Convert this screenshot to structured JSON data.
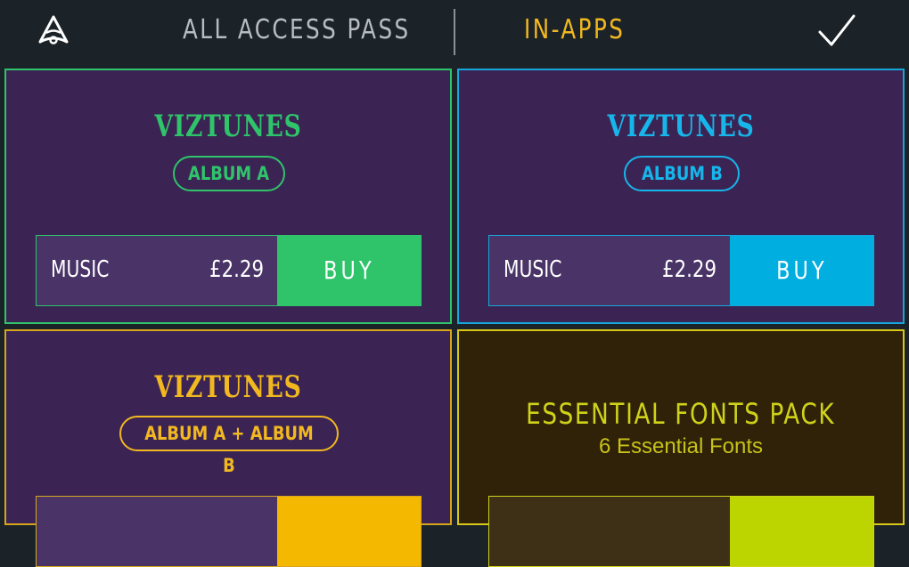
{
  "header": {
    "logo_icon": "app-logo-icon",
    "tab_all_access": "ALL ACCESS PASS",
    "tab_in_apps": "IN-APPS",
    "done_icon": "checkmark-icon"
  },
  "colors": {
    "green": "#2fc46a",
    "blue": "#17a6d9",
    "gold": "#f2b820",
    "lime": "#cfd21a"
  },
  "products": [
    {
      "brand": "VIZTUNES",
      "tag": "ALBUM A",
      "type": "MUSIC",
      "price": "£2.29",
      "buy": "BUY"
    },
    {
      "brand": "VIZTUNES",
      "tag": "ALBUM B",
      "type": "MUSIC",
      "price": "£2.29",
      "buy": "BUY"
    },
    {
      "brand": "VIZTUNES",
      "tag": "ALBUM A + ALBUM B"
    },
    {
      "title": "ESSENTIAL FONTS PACK",
      "subtitle": "6 Essential Fonts"
    }
  ]
}
